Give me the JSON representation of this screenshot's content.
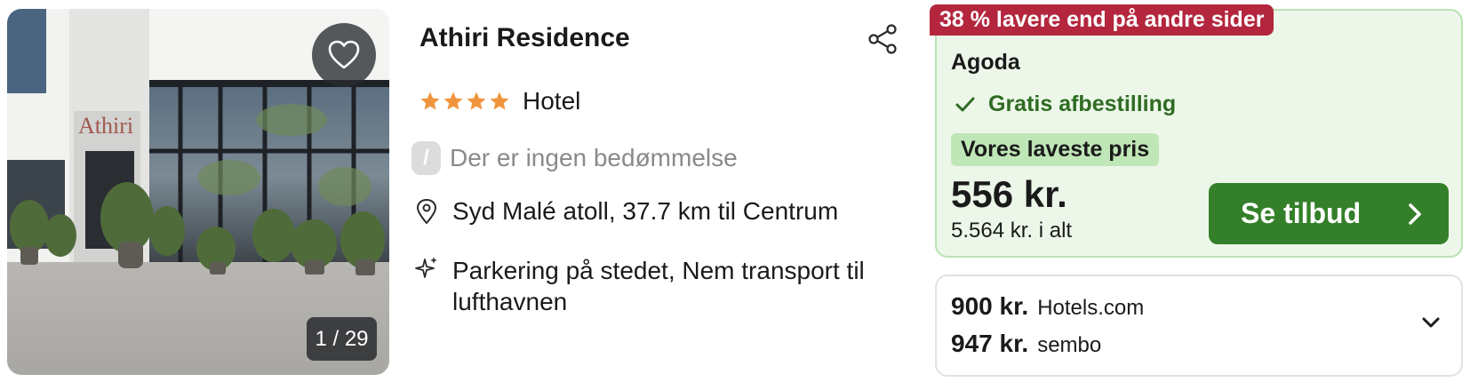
{
  "gallery": {
    "counter": "1 / 29",
    "building_sign": "Athiri",
    "favorite_icon": "heart-icon"
  },
  "hotel": {
    "name": "Athiri Residence",
    "star_rating": 4,
    "type": "Hotel",
    "rating_badge": "/",
    "rating_text": "Der er ingen bedømmelse",
    "location": "Syd Malé atoll, 37.7 km til Centrum",
    "amenities": "Parkering på stedet, Nem transport til lufthavnen",
    "share_icon": "share-icon"
  },
  "deal": {
    "ribbon": "38 % lavere end på andre sider",
    "provider": "Agoda",
    "cancellation": "Gratis afbestilling",
    "badge": "Vores laveste pris",
    "price": "556 kr.",
    "total": "5.564 kr. i alt",
    "cta": "Se tilbud",
    "colors": {
      "ribbon": "#b3263d",
      "cta": "#34802a",
      "card_bg": "#ecf7e9",
      "star": "#f0953e"
    }
  },
  "other_offers": [
    {
      "price": "900 kr.",
      "site": "Hotels.com"
    },
    {
      "price": "947 kr.",
      "site": "sembo"
    }
  ]
}
